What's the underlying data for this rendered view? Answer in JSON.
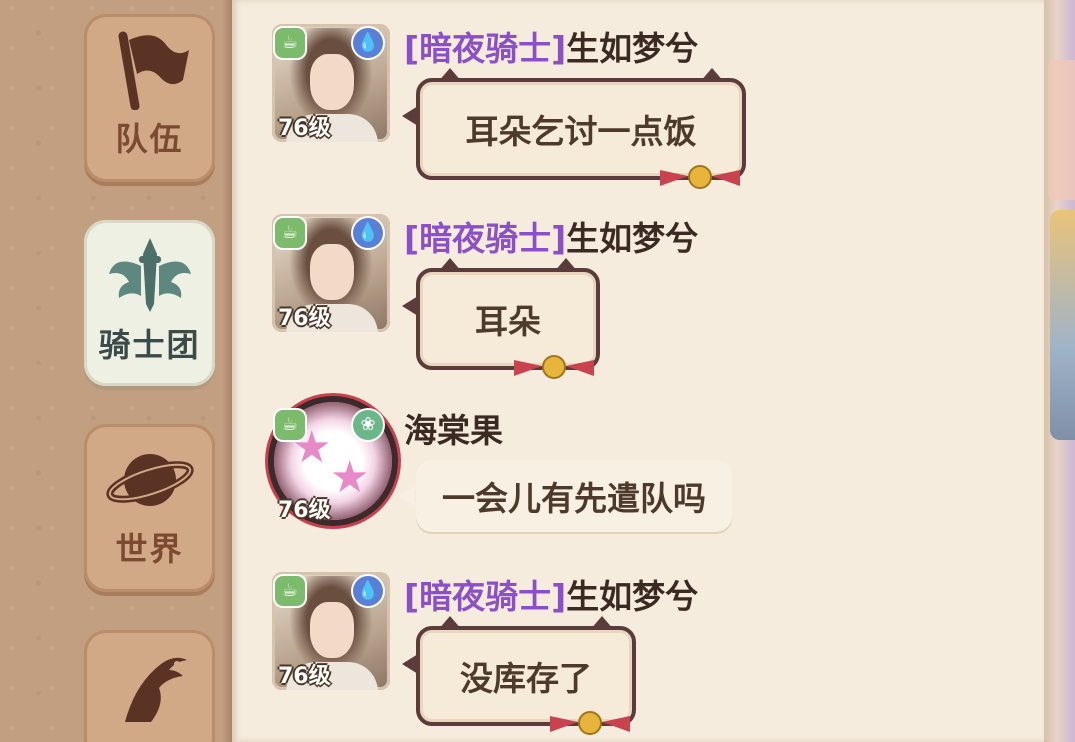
{
  "tabs": [
    {
      "label": "队伍",
      "icon": "flag-icon",
      "active": false
    },
    {
      "label": "骑士团",
      "icon": "knight-crest-icon",
      "active": true
    },
    {
      "label": "世界",
      "icon": "planet-icon",
      "active": false
    },
    {
      "label": "",
      "icon": "bird-icon",
      "active": false
    }
  ],
  "messages": [
    {
      "guild": "[暗夜骑士]",
      "name": "生如梦兮",
      "level": "76级",
      "text": "耳朵乞讨一点饭",
      "style": "cat-frame"
    },
    {
      "guild": "[暗夜骑士]",
      "name": "生如梦兮",
      "level": "76级",
      "text": "耳朵",
      "style": "cat-frame"
    },
    {
      "guild": "",
      "name": "海棠果",
      "level": "76级",
      "text": "一会儿有先遣队吗",
      "style": "plain"
    },
    {
      "guild": "[暗夜骑士]",
      "name": "生如梦兮",
      "level": "76级",
      "text": "没库存了",
      "style": "cat-frame"
    }
  ],
  "colors": {
    "guild": "#8a4fc9",
    "name": "#3a2a22",
    "bubble_border": "#5c3b3c",
    "panel": "#f5ecdd",
    "rail": "#c39f82"
  }
}
